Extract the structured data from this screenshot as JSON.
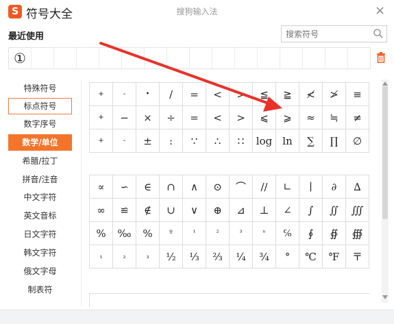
{
  "header": {
    "logo_letter": "S",
    "app_title": "符号大全",
    "window_title": "搜狗输入法",
    "close_glyph": "×"
  },
  "recent": {
    "label": "最近使用",
    "items": [
      "①",
      "",
      "",
      "",
      "",
      "",
      "",
      "",
      "",
      "",
      "",
      "",
      "",
      "",
      "",
      ""
    ]
  },
  "search": {
    "placeholder": "搜索符号",
    "icon": "search-icon"
  },
  "sidebar": {
    "items": [
      {
        "label": "特殊符号",
        "state": "normal"
      },
      {
        "label": "标点符号",
        "state": "outlined"
      },
      {
        "label": "数字序号",
        "state": "normal"
      },
      {
        "label": "数学/单位",
        "state": "active"
      },
      {
        "label": "希腊/拉丁",
        "state": "normal"
      },
      {
        "label": "拼音/注音",
        "state": "normal"
      },
      {
        "label": "中文字符",
        "state": "normal"
      },
      {
        "label": "英文音标",
        "state": "normal"
      },
      {
        "label": "日文字符",
        "state": "normal"
      },
      {
        "label": "韩文字符",
        "state": "normal"
      },
      {
        "label": "俄文字母",
        "state": "normal"
      },
      {
        "label": "制表符",
        "state": "normal"
      }
    ]
  },
  "grid1": [
    [
      "+",
      "-",
      "•",
      "/",
      "=",
      "<",
      ">",
      "≦",
      "≧",
      "≮",
      "≯",
      "≡"
    ],
    [
      "+",
      "−",
      "×",
      "÷",
      "=",
      "<",
      ">",
      "⩽",
      "⩾",
      "≈",
      "≒",
      "≠"
    ],
    [
      "+",
      "-",
      "±",
      ":",
      "∵",
      "∴",
      "∷",
      "log",
      "ln",
      "∑",
      "∏",
      "∅"
    ]
  ],
  "grid2": [
    [
      "∝",
      "∽",
      "∈",
      "∩",
      "∧",
      "⊙",
      "⌒",
      "//",
      "∟",
      "∣",
      "∂",
      "∆"
    ],
    [
      "∞",
      "≌",
      "∉",
      "∪",
      "∨",
      "⊕",
      "⊿",
      "⊥",
      "∠",
      "∫",
      "∬",
      "∭"
    ],
    [
      "%",
      "‰",
      "%",
      "º",
      "¹",
      "²",
      "³",
      "ⁿ",
      "℅",
      "∮",
      "∯",
      "∰"
    ],
    [
      "₁",
      "₂",
      "₃",
      "½",
      "⅓",
      "⅔",
      "¼",
      "¾",
      "°",
      "℃",
      "℉",
      "〒"
    ]
  ],
  "colors": {
    "accent": "#f4742a",
    "arrow": "#e8312a",
    "trash": "#f05a22"
  }
}
